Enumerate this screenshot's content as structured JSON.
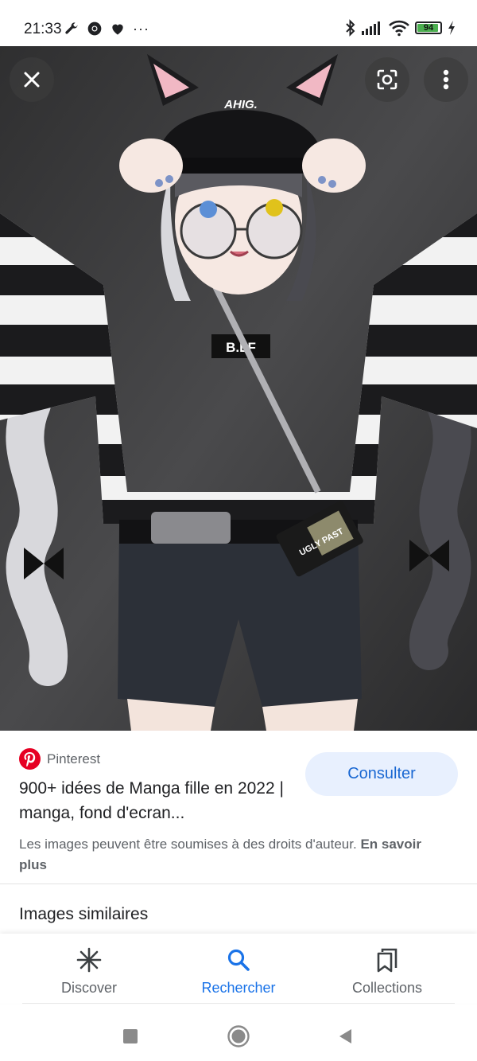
{
  "status_bar": {
    "time": "21:33",
    "more": "···",
    "battery_level": "94",
    "battery_fraction": 0.94,
    "icons": [
      "wrench-icon",
      "chrome-icon",
      "heart-icon",
      "bluetooth-icon",
      "signal-icon",
      "wifi-icon",
      "charging-icon"
    ]
  },
  "viewer": {
    "close_icon": "close-icon",
    "lens_icon": "google-lens-icon",
    "menu_icon": "more-vert-icon",
    "image_texts": {
      "cap_text": "AHIG.",
      "shirt_text": "B.LF",
      "badge_text": "UGLY PAST"
    }
  },
  "result": {
    "source_name": "Pinterest",
    "source_logo": "pinterest-logo",
    "title": "900+ idées de Manga fille en 2022 | manga, fond d'ecran...",
    "visit_button": "Consulter",
    "copyright_text": "Les images peuvent être soumises à des droits d'auteur. ",
    "copyright_link": "En savoir plus",
    "similar_heading": "Images similaires"
  },
  "bottom_nav": {
    "items": [
      {
        "label": "Discover",
        "icon": "asterisk-icon",
        "active": false
      },
      {
        "label": "Rechercher",
        "icon": "search-icon",
        "active": true
      },
      {
        "label": "Collections",
        "icon": "bookmarks-icon",
        "active": false
      }
    ]
  },
  "system_nav": [
    "recents-square-icon",
    "home-circle-icon",
    "back-triangle-icon"
  ],
  "colors": {
    "accent_blue": "#1a73e8",
    "visit_button_bg": "#e8f0fe",
    "pinterest_red": "#e60023",
    "battery_green": "#4caf50"
  }
}
